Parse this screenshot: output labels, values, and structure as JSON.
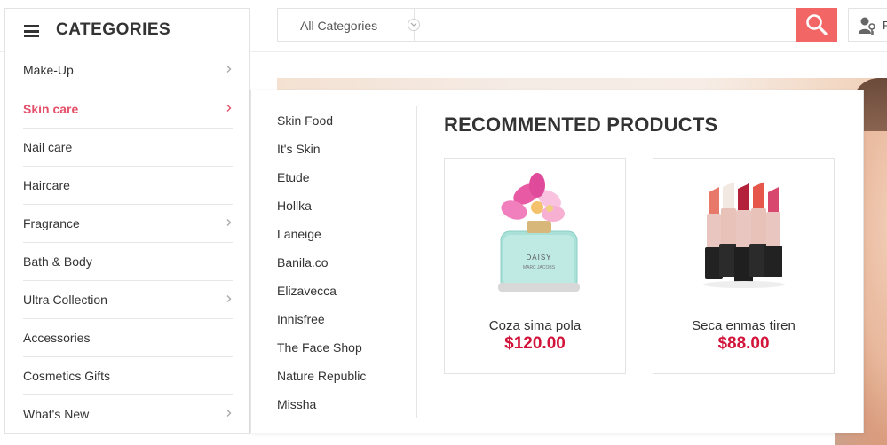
{
  "header": {
    "search": {
      "category_select": "All Categories",
      "placeholder": "",
      "value": ""
    },
    "account_text": "R"
  },
  "sidebar": {
    "title": "CATEGORIES",
    "items": [
      {
        "label": "Make-Up",
        "has_submenu": true
      },
      {
        "label": "Skin care",
        "has_submenu": true,
        "active": true
      },
      {
        "label": "Nail care",
        "has_submenu": false
      },
      {
        "label": "Haircare",
        "has_submenu": false
      },
      {
        "label": "Fragrance",
        "has_submenu": true
      },
      {
        "label": "Bath & Body",
        "has_submenu": false
      },
      {
        "label": "Ultra Collection",
        "has_submenu": true
      },
      {
        "label": "Accessories",
        "has_submenu": false
      },
      {
        "label": "Cosmetics Gifts",
        "has_submenu": false
      },
      {
        "label": "What's New",
        "has_submenu": true
      }
    ]
  },
  "mega_menu": {
    "brands": [
      "Skin Food",
      "It's Skin",
      "Etude",
      "Hollka",
      "Laneige",
      "Banila.co",
      "Elizavecca",
      "Innisfree",
      "The Face Shop",
      "Nature Republic",
      "Missha"
    ],
    "recommended_title": "RECOMMENTED PRODUCTS",
    "products": [
      {
        "name": "Coza sima pola",
        "price": "$120.00",
        "image": "perfume-bottle-image"
      },
      {
        "name": "Seca enmas tiren",
        "price": "$88.00",
        "image": "lipsticks-image"
      }
    ]
  },
  "colors": {
    "accent": "#f26765",
    "active_category": "#e5506a",
    "price": "#d2143a"
  },
  "icons": [
    "hamburger-icon",
    "search-icon",
    "chevron-down-icon",
    "chevron-right-icon",
    "user-key-icon"
  ]
}
